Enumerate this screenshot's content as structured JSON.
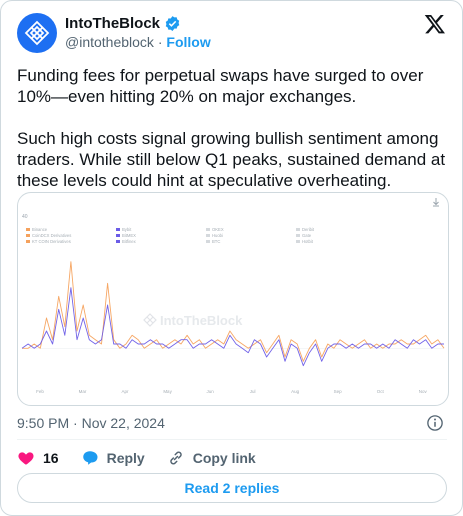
{
  "author": {
    "name": "IntoTheBlock",
    "handle": "@intotheblock",
    "follow_label": "Follow"
  },
  "post": {
    "text": "Funding fees for perpetual swaps have surged to over 10%—even hitting 20% on major exchanges.\n\nSuch high costs signal growing bullish sentiment among traders. While still below Q1 peaks, sustained demand at these levels could hint at speculative overheating.",
    "timestamp": "9:50 PM · Nov 22, 2024"
  },
  "actions": {
    "like_count": "16",
    "reply_label": "Reply",
    "copy_link_label": "Copy link"
  },
  "read_replies_label": "Read 2 replies",
  "colors": {
    "accent": "#1d9bf0",
    "like": "#f91880",
    "series_orange": "#f5a25d",
    "series_purple": "#6b5ce7"
  },
  "chart_data": {
    "type": "line",
    "watermark": "IntoTheBlock",
    "y_axis_label": "40",
    "legend": [
      "Binance",
      "Bybit",
      "OKEX",
      "Deribit",
      "CoinDCX Derivatives",
      "BitMEX",
      "Huobi",
      "Gate",
      "KT COIN Derivatives",
      "Bitfinex",
      "BTC",
      "Hotbit"
    ],
    "x_ticks": [
      "Feb",
      "Mar",
      "Apr",
      "May",
      "Jun",
      "Jul",
      "Aug",
      "Sep",
      "Oct",
      "Nov"
    ],
    "series": [
      {
        "name": "Binance",
        "color": "#f5a25d",
        "values": [
          0,
          0,
          1,
          0,
          7,
          2,
          12,
          5,
          20,
          4,
          10,
          3,
          2,
          1,
          15,
          2,
          0,
          1,
          3,
          2,
          0,
          1,
          2,
          0,
          1,
          2,
          1,
          3,
          1,
          2,
          0,
          1,
          2,
          1,
          4,
          2,
          1,
          0,
          1,
          2,
          -1,
          1,
          3,
          -2,
          2,
          1,
          -3,
          0,
          2,
          -2,
          1,
          0,
          2,
          1,
          0,
          1,
          2,
          0,
          1,
          0,
          1,
          1,
          2,
          1,
          1,
          2,
          3,
          1,
          2,
          0
        ]
      },
      {
        "name": "Bybit",
        "color": "#6b5ce7",
        "values": [
          0,
          1,
          0,
          1,
          4,
          1,
          9,
          3,
          14,
          2,
          7,
          2,
          1,
          2,
          10,
          1,
          1,
          0,
          2,
          1,
          1,
          2,
          1,
          1,
          0,
          1,
          2,
          2,
          0,
          1,
          1,
          2,
          1,
          0,
          3,
          1,
          0,
          -1,
          2,
          1,
          -2,
          0,
          2,
          -3,
          1,
          0,
          -4,
          -1,
          1,
          -3,
          0,
          1,
          1,
          0,
          1,
          0,
          1,
          1,
          0,
          1,
          0,
          2,
          1,
          0,
          2,
          1,
          2,
          0,
          1,
          1
        ]
      }
    ]
  }
}
